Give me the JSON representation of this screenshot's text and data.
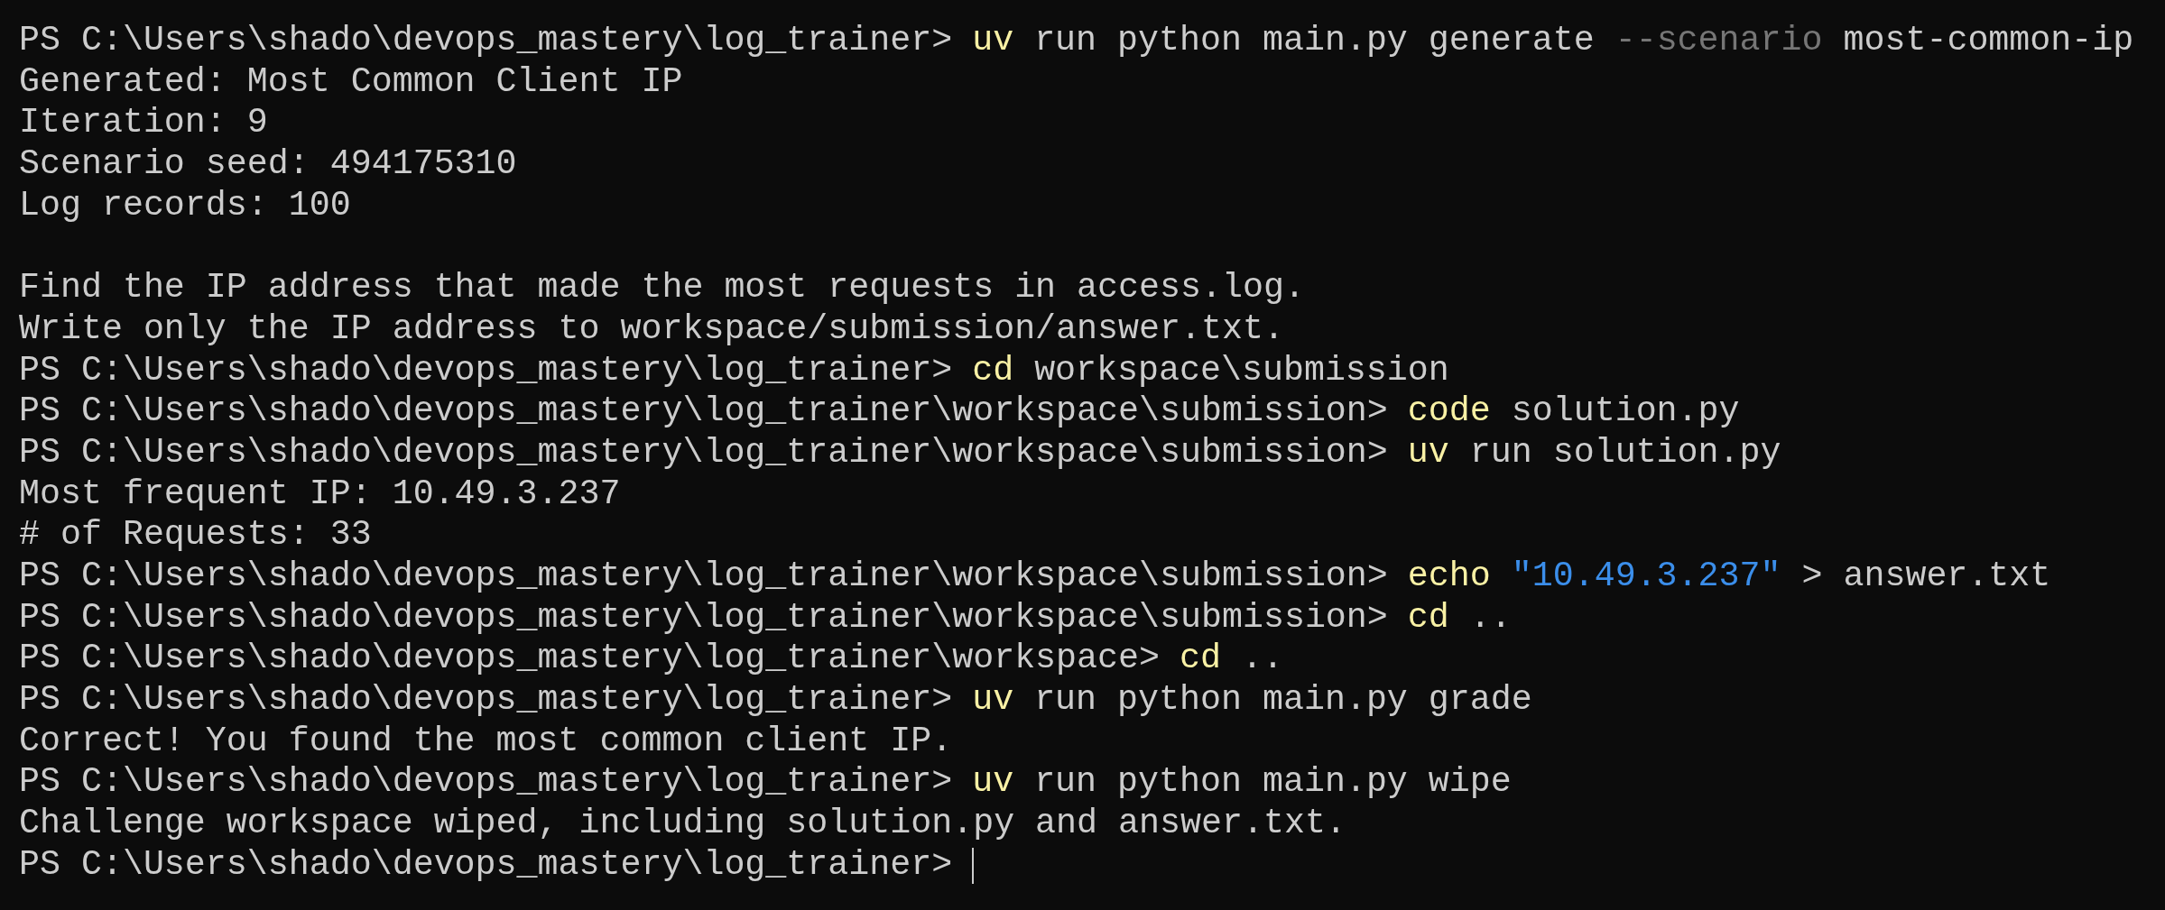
{
  "terminal": {
    "lines": [
      {
        "kind": "prompt",
        "prompt": "PS C:\\Users\\shado\\devops_mastery\\log_trainer>",
        "tokens": [
          {
            "text": "uv",
            "kind": "command"
          },
          {
            "text": "run",
            "kind": "plain"
          },
          {
            "text": "python",
            "kind": "plain"
          },
          {
            "text": "main.py",
            "kind": "plain"
          },
          {
            "text": "generate",
            "kind": "plain"
          },
          {
            "text": "--scenario",
            "kind": "parameter"
          },
          {
            "text": "most-common-ip",
            "kind": "plain"
          }
        ]
      },
      {
        "kind": "output",
        "text": "Generated: Most Common Client IP"
      },
      {
        "kind": "output",
        "text": "Iteration: 9"
      },
      {
        "kind": "output",
        "text": "Scenario seed: 494175310"
      },
      {
        "kind": "output",
        "text": "Log records: 100"
      },
      {
        "kind": "blank"
      },
      {
        "kind": "output",
        "text": "Find the IP address that made the most requests in access.log."
      },
      {
        "kind": "output",
        "text": "Write only the IP address to workspace/submission/answer.txt."
      },
      {
        "kind": "prompt",
        "prompt": "PS C:\\Users\\shado\\devops_mastery\\log_trainer>",
        "tokens": [
          {
            "text": "cd",
            "kind": "command"
          },
          {
            "text": "workspace\\submission",
            "kind": "plain"
          }
        ]
      },
      {
        "kind": "prompt",
        "prompt": "PS C:\\Users\\shado\\devops_mastery\\log_trainer\\workspace\\submission>",
        "tokens": [
          {
            "text": "code",
            "kind": "command"
          },
          {
            "text": "solution.py",
            "kind": "plain"
          }
        ]
      },
      {
        "kind": "prompt",
        "prompt": "PS C:\\Users\\shado\\devops_mastery\\log_trainer\\workspace\\submission>",
        "tokens": [
          {
            "text": "uv",
            "kind": "command"
          },
          {
            "text": "run",
            "kind": "plain"
          },
          {
            "text": "solution.py",
            "kind": "plain"
          }
        ]
      },
      {
        "kind": "output",
        "text": "Most frequent IP: 10.49.3.237"
      },
      {
        "kind": "output",
        "text": "# of Requests: 33"
      },
      {
        "kind": "prompt",
        "prompt": "PS C:\\Users\\shado\\devops_mastery\\log_trainer\\workspace\\submission>",
        "tokens": [
          {
            "text": "echo",
            "kind": "command"
          },
          {
            "text": "\"10.49.3.237\"",
            "kind": "string"
          },
          {
            "text": ">",
            "kind": "plain"
          },
          {
            "text": "answer.txt",
            "kind": "plain"
          }
        ]
      },
      {
        "kind": "prompt",
        "prompt": "PS C:\\Users\\shado\\devops_mastery\\log_trainer\\workspace\\submission>",
        "tokens": [
          {
            "text": "cd",
            "kind": "command"
          },
          {
            "text": "..",
            "kind": "plain"
          }
        ]
      },
      {
        "kind": "prompt",
        "prompt": "PS C:\\Users\\shado\\devops_mastery\\log_trainer\\workspace>",
        "tokens": [
          {
            "text": "cd",
            "kind": "command"
          },
          {
            "text": "..",
            "kind": "plain"
          }
        ]
      },
      {
        "kind": "prompt",
        "prompt": "PS C:\\Users\\shado\\devops_mastery\\log_trainer>",
        "tokens": [
          {
            "text": "uv",
            "kind": "command"
          },
          {
            "text": "run",
            "kind": "plain"
          },
          {
            "text": "python",
            "kind": "plain"
          },
          {
            "text": "main.py",
            "kind": "plain"
          },
          {
            "text": "grade",
            "kind": "plain"
          }
        ]
      },
      {
        "kind": "output",
        "text": "Correct! You found the most common client IP."
      },
      {
        "kind": "prompt",
        "prompt": "PS C:\\Users\\shado\\devops_mastery\\log_trainer>",
        "tokens": [
          {
            "text": "uv",
            "kind": "command"
          },
          {
            "text": "run",
            "kind": "plain"
          },
          {
            "text": "python",
            "kind": "plain"
          },
          {
            "text": "main.py",
            "kind": "plain"
          },
          {
            "text": "wipe",
            "kind": "plain"
          }
        ]
      },
      {
        "kind": "output",
        "text": "Challenge workspace wiped, including solution.py and answer.txt."
      },
      {
        "kind": "prompt",
        "prompt": "PS C:\\Users\\shado\\devops_mastery\\log_trainer>",
        "cursor": true
      }
    ]
  }
}
